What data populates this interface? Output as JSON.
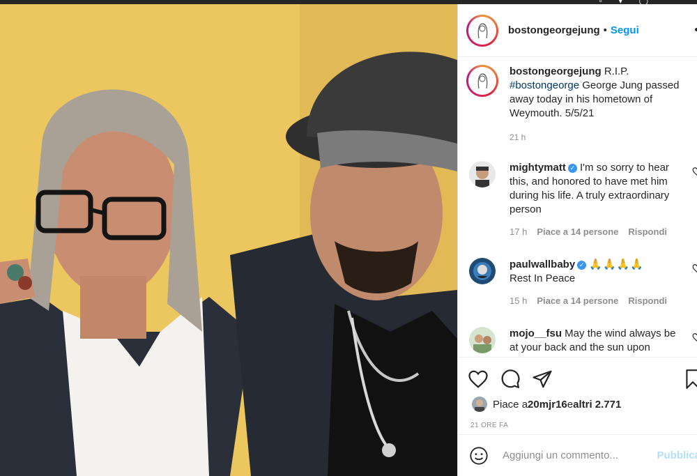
{
  "top_bar": {
    "left_text": "...ng ..."
  },
  "post": {
    "author": "bostongeorgejung",
    "separator": "•",
    "follow_label": "Segui"
  },
  "caption": {
    "author": "bostongeorgejung",
    "text_before": " R.I.P. ",
    "hashtag": "#bostongeorge",
    "text_after": " George Jung passed away today in his hometown of Weymouth. 5/5/21",
    "time": "21 h"
  },
  "comments": [
    {
      "author": "mightymatt",
      "verified": true,
      "text": " I'm so sorry to hear this, and honored to have met him during his life. A truly extraordinary person",
      "time": "17 h",
      "likes": "Piace a 14 persone",
      "reply": "Rispondi"
    },
    {
      "author": "paulwallbaby",
      "verified": true,
      "text": "🙏🙏🙏🙏",
      "text2": "Rest In Peace",
      "time": "15 h",
      "likes": "Piace a 14 persone",
      "reply": "Rispondi"
    },
    {
      "author": "mojo__fsu",
      "verified": false,
      "text": " May the wind always be at your back and the sun upon"
    }
  ],
  "likes_line": {
    "prefix": "Piace a ",
    "user": "20mjr16",
    "middle": " e ",
    "others": "altri 2.771"
  },
  "posted_ago": "21 ore fa",
  "add_comment": {
    "placeholder": "Aggiungi un commento...",
    "publish_label": "Pubblica"
  },
  "colors": {
    "link_blue": "#0095f6",
    "hashtag_blue": "#00376b",
    "muted_gray": "#8e8e8e",
    "publish_disabled": "#b2dffc",
    "photo_background": "#f1cf64"
  }
}
